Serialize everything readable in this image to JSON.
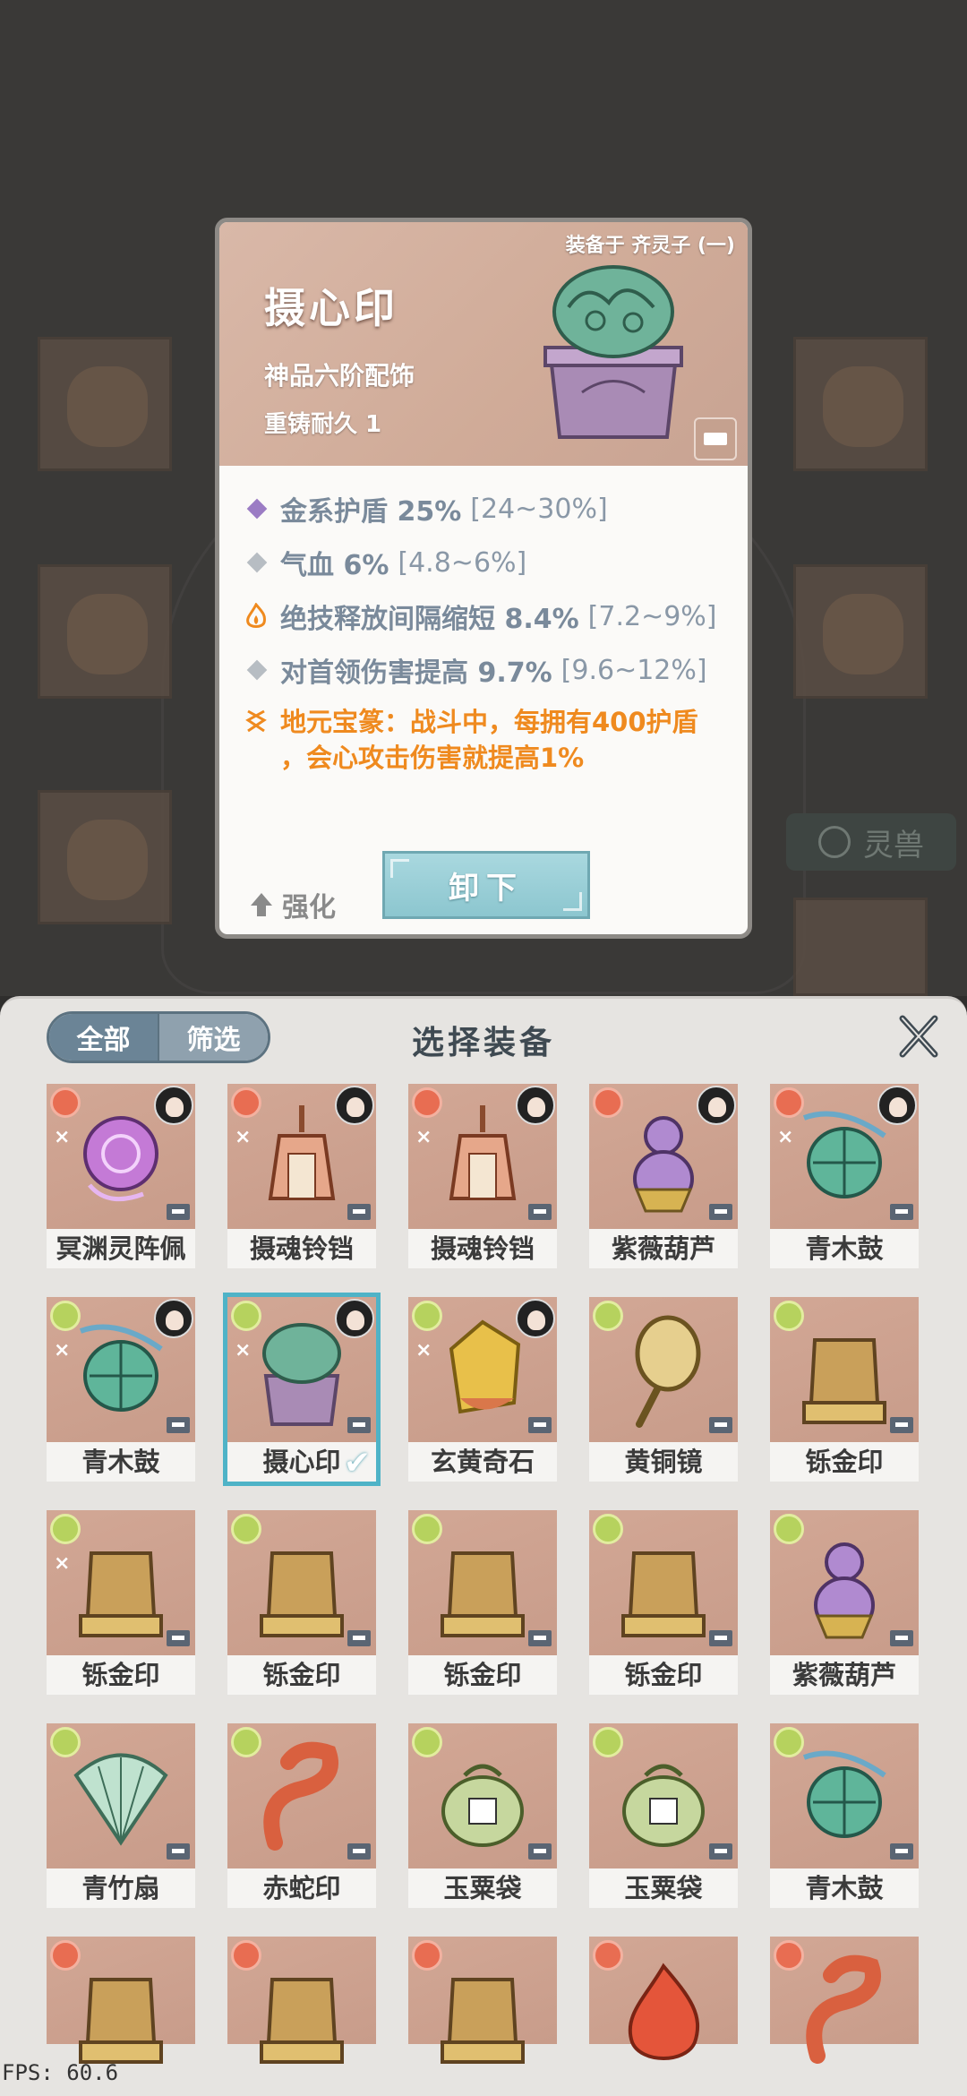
{
  "detail": {
    "equipped_by": "装备于 齐灵子 (一)",
    "name": "摄心印",
    "grade": "神品六阶配饰",
    "durability": "重铸耐久 1",
    "stats": [
      {
        "name": "金系护盾 25%",
        "range": "[24~30%]",
        "marker": "diamond-purple",
        "color": "#9b7cc4"
      },
      {
        "name": "气血 6%",
        "range": "[4.8~6%]",
        "marker": "diamond-gray",
        "color": "#b7bdc3"
      },
      {
        "name": "绝技释放间隔缩短 8.4%",
        "range": "[7.2~9%]",
        "marker": "flame-orange",
        "color": "#ef8a1f"
      },
      {
        "name": "对首领伤害提高 9.7%",
        "range": "[9.6~12%]",
        "marker": "diamond-gray",
        "color": "#b7bdc3"
      }
    ],
    "special_line1": "地元宝篆：战斗中，每拥有400护盾",
    "special_line2": "，会心攻击伤害就提高1%",
    "upgrade_label": "强化",
    "unequip_label": "卸下"
  },
  "background": {
    "tag_label": "灵兽"
  },
  "panel": {
    "title": "选择装备",
    "filter_all": "全部",
    "filter_select": "筛选",
    "close_label": "X",
    "items": [
      {
        "label": "冥渊灵阵佩",
        "badge": "red",
        "avatar": true,
        "swirl": true,
        "art": "purple-orb"
      },
      {
        "label": "摄魂铃铛",
        "badge": "red",
        "avatar": true,
        "swirl": true,
        "art": "bell"
      },
      {
        "label": "摄魂铃铛",
        "badge": "red",
        "avatar": true,
        "swirl": true,
        "art": "bell"
      },
      {
        "label": "紫薇葫芦",
        "badge": "red",
        "avatar": true,
        "swirl": false,
        "art": "gourd"
      },
      {
        "label": "青木鼓",
        "badge": "red",
        "avatar": true,
        "swirl": true,
        "art": "drum"
      },
      {
        "label": "青木鼓",
        "badge": "green",
        "avatar": true,
        "swirl": true,
        "art": "drum"
      },
      {
        "label": "摄心印",
        "badge": "green",
        "avatar": true,
        "swirl": true,
        "art": "seal-jade",
        "selected": true
      },
      {
        "label": "玄黄奇石",
        "badge": "green",
        "avatar": true,
        "swirl": true,
        "art": "stone"
      },
      {
        "label": "黄铜镜",
        "badge": "green",
        "avatar": false,
        "swirl": false,
        "art": "mirror"
      },
      {
        "label": "铄金印",
        "badge": "green",
        "avatar": false,
        "swirl": false,
        "art": "seal-gold"
      },
      {
        "label": "铄金印",
        "badge": "green",
        "avatar": false,
        "swirl": true,
        "art": "seal-gold"
      },
      {
        "label": "铄金印",
        "badge": "green",
        "avatar": false,
        "swirl": false,
        "art": "seal-gold"
      },
      {
        "label": "铄金印",
        "badge": "green",
        "avatar": false,
        "swirl": false,
        "art": "seal-gold"
      },
      {
        "label": "铄金印",
        "badge": "green",
        "avatar": false,
        "swirl": false,
        "art": "seal-gold"
      },
      {
        "label": "紫薇葫芦",
        "badge": "green",
        "avatar": false,
        "swirl": false,
        "art": "gourd"
      },
      {
        "label": "青竹扇",
        "badge": "green",
        "avatar": false,
        "swirl": false,
        "art": "fan"
      },
      {
        "label": "赤蛇印",
        "badge": "green",
        "avatar": false,
        "swirl": false,
        "art": "snake"
      },
      {
        "label": "玉粟袋",
        "badge": "green",
        "avatar": false,
        "swirl": false,
        "art": "bag"
      },
      {
        "label": "玉粟袋",
        "badge": "green",
        "avatar": false,
        "swirl": false,
        "art": "bag"
      },
      {
        "label": "青木鼓",
        "badge": "green",
        "avatar": false,
        "swirl": false,
        "art": "drum"
      },
      {
        "label": "",
        "badge": "red",
        "avatar": false,
        "swirl": false,
        "art": "seal-gold"
      },
      {
        "label": "",
        "badge": "red",
        "avatar": false,
        "swirl": false,
        "art": "seal-gold"
      },
      {
        "label": "",
        "badge": "red",
        "avatar": false,
        "swirl": false,
        "art": "seal-gold"
      },
      {
        "label": "",
        "badge": "red",
        "avatar": false,
        "swirl": false,
        "art": "flame"
      },
      {
        "label": "",
        "badge": "red",
        "avatar": false,
        "swirl": false,
        "art": "snake"
      }
    ]
  },
  "fps": "FPS: 60.6"
}
